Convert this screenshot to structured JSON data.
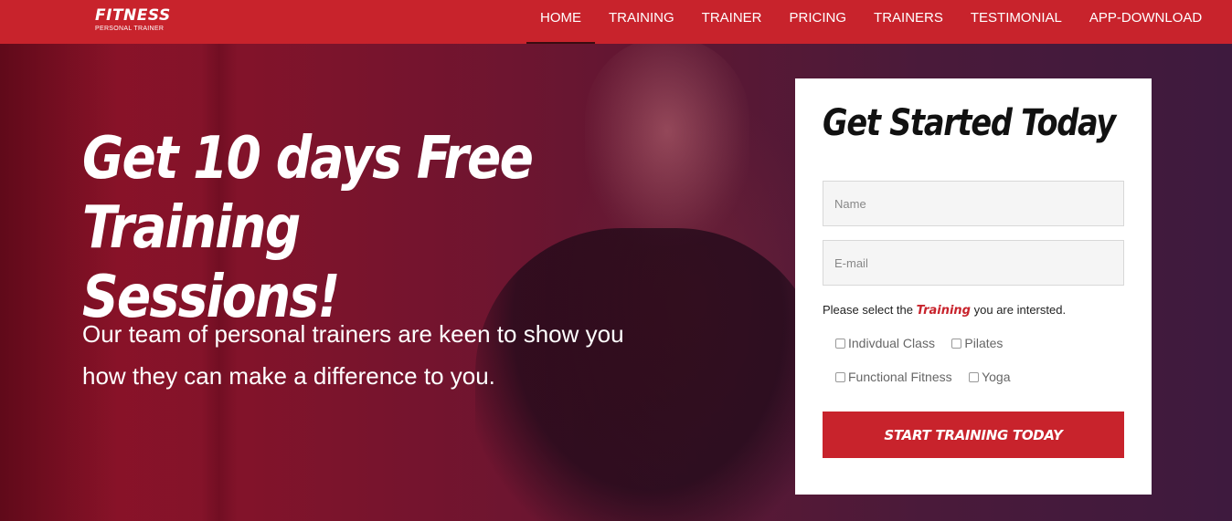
{
  "brand": {
    "title": "FITNESS",
    "subtitle": "PERSONAL TRAINER"
  },
  "nav": {
    "items": [
      {
        "label": "HOME",
        "active": true
      },
      {
        "label": "TRAINING",
        "active": false
      },
      {
        "label": "TRAINER",
        "active": false
      },
      {
        "label": "PRICING",
        "active": false
      },
      {
        "label": "TRAINERS",
        "active": false
      },
      {
        "label": "TESTIMONIAL",
        "active": false
      },
      {
        "label": "APP-DOWNLOAD",
        "active": false
      }
    ]
  },
  "hero": {
    "headline_line1": "Get 10 days Free",
    "headline_line2": "Training Sessions!",
    "subtext_line1": "Our team of personal trainers are keen to show you",
    "subtext_line2": "how they can make a difference to you."
  },
  "form": {
    "title": "Get Started Today",
    "name_placeholder": "Name",
    "email_placeholder": "E-mail",
    "prompt_before": "Please select the",
    "prompt_highlight": "Training",
    "prompt_after": "you are intersted.",
    "options_row1": [
      "Indivdual Class",
      "Pilates"
    ],
    "options_row2": [
      "Functional Fitness",
      "Yoga"
    ],
    "submit_label": "START TRAINING TODAY"
  },
  "colors": {
    "brand_red": "#c8232c",
    "card_bg": "#ffffff"
  }
}
